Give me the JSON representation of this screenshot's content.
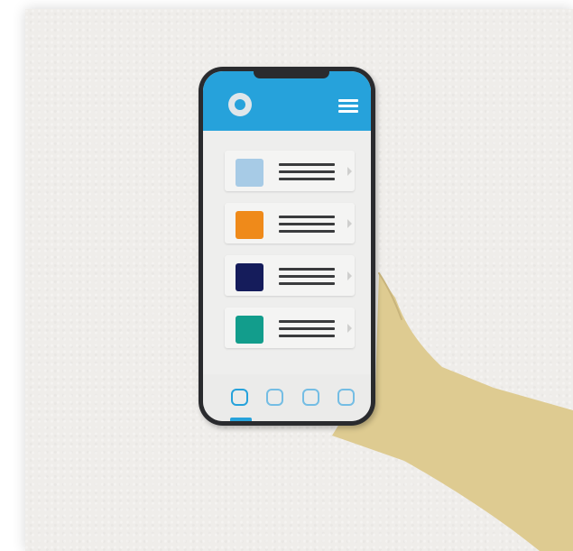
{
  "colors": {
    "paper": "#efedea",
    "hand": "#decb91",
    "phone_frame": "#2a2b2e",
    "app_header": "#26a2db",
    "screen_background": "#eeeeed",
    "menu_icon": "#ffffff",
    "text_line": "#3a3b3d"
  },
  "app": {
    "header": {
      "logo_icon": "circle-logo-icon",
      "menu_icon": "hamburger-menu-icon"
    },
    "list_items": [
      {
        "swatch_color": "#a7cbe6",
        "icon": "chevron-right-icon"
      },
      {
        "swatch_color": "#ef8a1a",
        "icon": "chevron-right-icon"
      },
      {
        "swatch_color": "#151c5b",
        "icon": "chevron-right-icon"
      },
      {
        "swatch_color": "#129d8c",
        "icon": "chevron-right-icon"
      }
    ],
    "tabs": [
      {
        "icon": "rounded-square-icon",
        "selected": true,
        "color": "#26a2db"
      },
      {
        "icon": "rounded-square-icon",
        "selected": false,
        "color": "#74bde4"
      },
      {
        "icon": "rounded-square-icon",
        "selected": false,
        "color": "#74bde4"
      },
      {
        "icon": "rounded-square-icon",
        "selected": false,
        "color": "#74bde4"
      }
    ]
  }
}
